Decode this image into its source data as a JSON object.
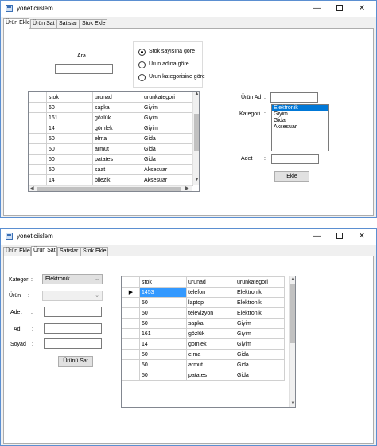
{
  "app_title": "yoneticiislem",
  "tabs": [
    "Ürün Ekle",
    "Ürün Sat",
    "Satislar",
    "Stok Ekle"
  ],
  "window1": {
    "active_tab": 0,
    "search_label": "Ara",
    "search_value": "",
    "sort_options": [
      {
        "label": "Stok sayısına göre",
        "checked": true
      },
      {
        "label": "Urun adına göre",
        "checked": false
      },
      {
        "label": "Urun kategorisine göre",
        "checked": false
      }
    ],
    "grid": {
      "columns": [
        "stok",
        "urunad",
        "urunkategori"
      ],
      "rows": [
        [
          "60",
          "sapka",
          "Giyim"
        ],
        [
          "161",
          "gözlük",
          "Giyim"
        ],
        [
          "14",
          "gömlek",
          "Giyim"
        ],
        [
          "50",
          "elma",
          "Gida"
        ],
        [
          "50",
          "armut",
          "Gida"
        ],
        [
          "50",
          "patates",
          "Gida"
        ],
        [
          "50",
          "saat",
          "Aksesuar"
        ],
        [
          "14",
          "bilezik",
          "Aksesuar"
        ]
      ]
    },
    "form": {
      "name_label": "Ürün Ad",
      "name_colon": ":",
      "name_value": "",
      "category_label": "Kategori",
      "category_colon": ":",
      "categories": [
        "Elektronik",
        "Giyim",
        "Gida",
        "Aksesuar"
      ],
      "selected_category": 0,
      "quantity_label": "Adet",
      "quantity_colon": ":",
      "quantity_value": "",
      "add_button": "Ekle"
    }
  },
  "window2": {
    "active_tab": 1,
    "form": {
      "category_label": "Kategori :",
      "category_value": "Elektronik",
      "product_label": "Ürün",
      "product_colon": ":",
      "product_value": "",
      "quantity_label": "Adet",
      "quantity_colon": ":",
      "quantity_value": "",
      "name_label": "Ad",
      "name_colon": ":",
      "name_value": "",
      "surname_label": "Soyad",
      "surname_colon": ":",
      "surname_value": "",
      "sell_button": "Ürünü Sat"
    },
    "grid": {
      "columns": [
        "stok",
        "urunad",
        "urunkategori"
      ],
      "selected_row": 0,
      "rows": [
        [
          "1453",
          "telefon",
          "Elektronik"
        ],
        [
          "50",
          "laptop",
          "Elektronik"
        ],
        [
          "50",
          "televizyon",
          "Elektronik"
        ],
        [
          "60",
          "sapka",
          "Giyim"
        ],
        [
          "161",
          "gözlük",
          "Giyim"
        ],
        [
          "14",
          "gömlek",
          "Giyim"
        ],
        [
          "50",
          "elma",
          "Gida"
        ],
        [
          "50",
          "armut",
          "Gida"
        ],
        [
          "50",
          "patates",
          "Gida"
        ]
      ]
    }
  },
  "icons": {
    "minimize": "minimize-icon",
    "maximize": "maximize-icon",
    "close": "close-icon"
  }
}
